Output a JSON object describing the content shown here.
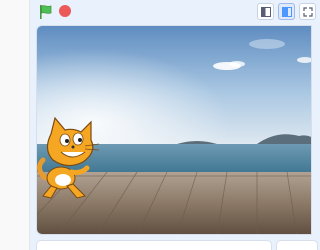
{
  "app": {
    "toolbar": {
      "green_flag_icon": "green-flag-icon",
      "stop_icon": "stop-sign-icon",
      "small_stage_icon": "small-stage-icon",
      "normal_stage_icon": "normal-stage-icon",
      "fullscreen_icon": "fullscreen-icon"
    },
    "stage": {
      "backdrop": "beach boardwalk",
      "sprite": "cat"
    },
    "colors": {
      "flag_green": "#4cbf56",
      "stop_red": "#ec5959",
      "sky_top": "#6f98c6",
      "sea": "#4a7d98",
      "boardwalk": "#8a7560"
    }
  }
}
